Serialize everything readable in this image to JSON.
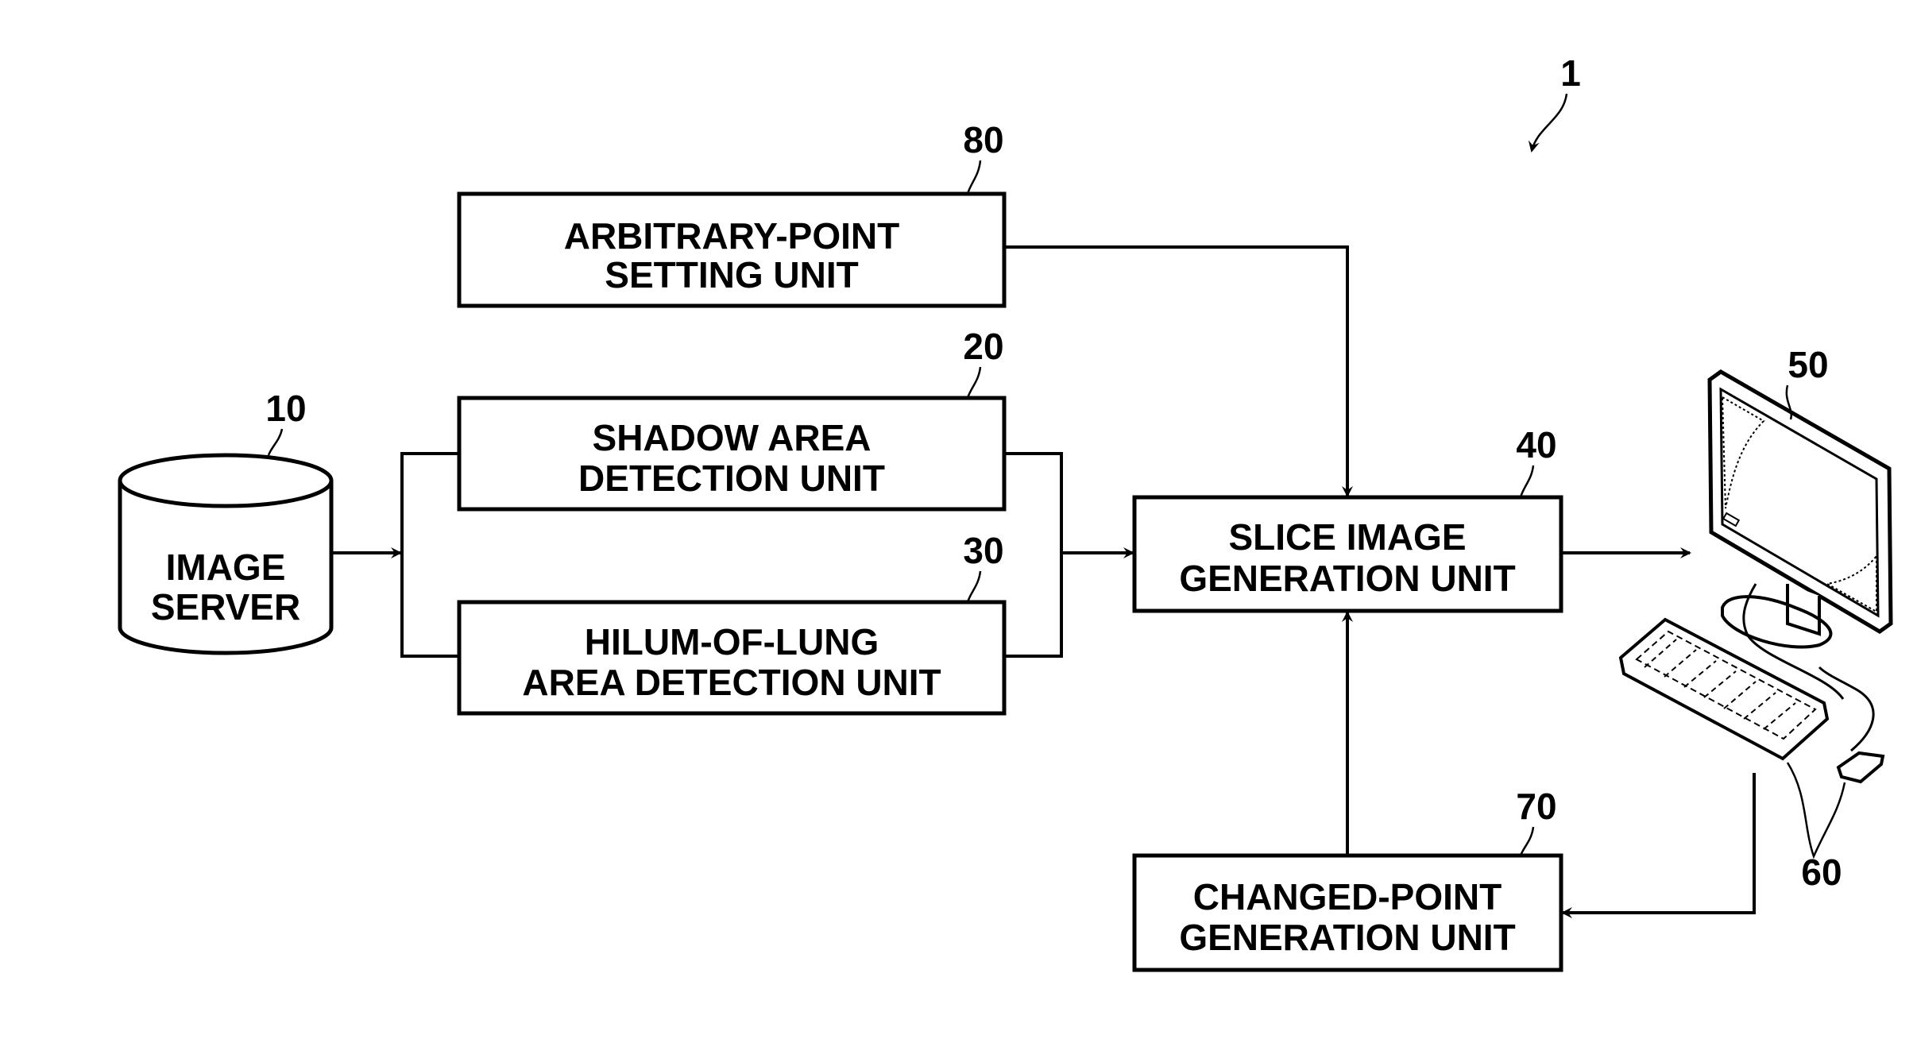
{
  "figure": {
    "system_ref": "1",
    "nodes": [
      {
        "id": "image_server",
        "ref": "10",
        "lines": [
          "IMAGE",
          "SERVER"
        ],
        "shape": "cylinder"
      },
      {
        "id": "shadow",
        "ref": "20",
        "lines": [
          "SHADOW AREA",
          "DETECTION UNIT"
        ]
      },
      {
        "id": "hilum",
        "ref": "30",
        "lines": [
          "HILUM-OF-LUNG",
          "AREA DETECTION UNIT"
        ]
      },
      {
        "id": "slice",
        "ref": "40",
        "lines": [
          "SLICE IMAGE",
          "GENERATION UNIT"
        ]
      },
      {
        "id": "display",
        "ref": "50",
        "shape": "monitor"
      },
      {
        "id": "input",
        "ref": "60",
        "shape": "keyboard-and-mouse"
      },
      {
        "id": "changed",
        "ref": "70",
        "lines": [
          "CHANGED-POINT",
          "GENERATION UNIT"
        ]
      },
      {
        "id": "arbitrary",
        "ref": "80",
        "lines": [
          "ARBITRARY-POINT",
          "SETTING UNIT"
        ]
      }
    ],
    "edges": [
      {
        "from": "image_server",
        "to": [
          "shadow",
          "hilum"
        ]
      },
      {
        "from": [
          "shadow",
          "hilum"
        ],
        "to": "slice"
      },
      {
        "from": "arbitrary",
        "to": "slice"
      },
      {
        "from": "slice",
        "to": "display"
      },
      {
        "from": "input",
        "to": "changed"
      },
      {
        "from": "changed",
        "to": "slice"
      }
    ]
  }
}
